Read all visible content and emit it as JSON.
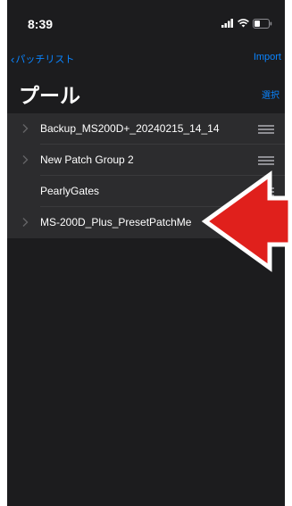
{
  "status_bar": {
    "time": "8:39"
  },
  "nav": {
    "back_label": "パッチリスト",
    "import_label": "Import"
  },
  "header": {
    "title": "プール",
    "select_label": "選択"
  },
  "pool_list": {
    "items": [
      {
        "label": "Backup_MS200D+_20240215_14_14",
        "has_disclosure": true,
        "has_reorder": true
      },
      {
        "label": "New Patch Group 2",
        "has_disclosure": true,
        "has_reorder": true
      },
      {
        "label": "PearlyGates",
        "has_disclosure": false,
        "has_reorder": true
      },
      {
        "label": "MS-200D_Plus_PresetPatchMe",
        "has_disclosure": true,
        "has_reorder": false
      }
    ]
  },
  "colors": {
    "background": "#1c1c1e",
    "list_background": "#2c2c2e",
    "accent": "#0a84ff",
    "annotation_arrow": "#e0201c"
  },
  "icons": {
    "back": "chevron-left-icon",
    "disclosure": "chevron-right-icon",
    "reorder": "reorder-handle-icon",
    "signal": "signal-icon",
    "wifi": "wifi-icon",
    "battery": "battery-icon",
    "annotation": "red-arrow-icon"
  }
}
